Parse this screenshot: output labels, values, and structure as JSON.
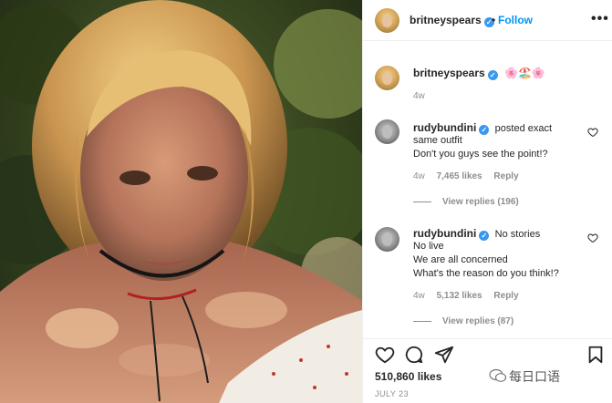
{
  "post": {
    "author": "britneyspears",
    "follow_label": "Follow",
    "header_dot": "•",
    "more_label": "•••",
    "caption_emojis": "🌸🏖️🌸",
    "caption_age": "4w",
    "likes": "510,860 likes",
    "date": "JULY 23"
  },
  "comments": [
    {
      "author": "rudybundini",
      "lines": [
        "posted exact",
        "same outfit",
        "Don't you guys see the point!?"
      ],
      "age": "4w",
      "likes": "7,465 likes",
      "reply_label": "Reply",
      "view_replies": "View replies (196)"
    },
    {
      "author": "rudybundini",
      "lines": [
        "No stories",
        "No live",
        "We are all concerned",
        "What's the reason do you think!?"
      ],
      "age": "4w",
      "likes": "5,132 likes",
      "reply_label": "Reply",
      "view_replies": "View replies (87)"
    }
  ],
  "icons": {
    "verified": "verified-badge",
    "heart": "heart-icon",
    "comment": "comment-icon",
    "share": "share-icon",
    "save": "bookmark-icon"
  },
  "watermark": "每日口语",
  "verified_glyph": "✓",
  "colors": {
    "link": "#0095f6",
    "verified": "#3897f0",
    "muted": "#8e8e8e"
  }
}
